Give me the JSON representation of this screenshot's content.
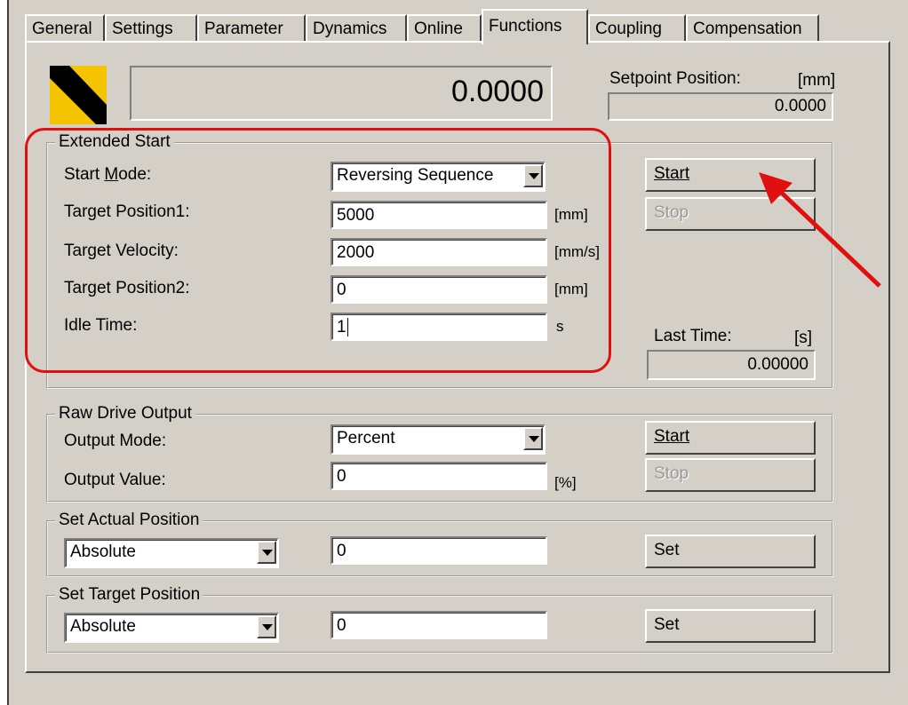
{
  "tabs": [
    {
      "label": "General",
      "active": false
    },
    {
      "label": "Settings",
      "active": false
    },
    {
      "label": "Parameter",
      "active": false
    },
    {
      "label": "Dynamics",
      "active": false
    },
    {
      "label": "Online",
      "active": false
    },
    {
      "label": "Functions",
      "active": true
    },
    {
      "label": "Coupling",
      "active": false
    },
    {
      "label": "Compensation",
      "active": false
    }
  ],
  "logo": {
    "colors": [
      "#f5c400",
      "#000000"
    ],
    "icon": "warning-stripes-icon"
  },
  "actual_value": "0.0000",
  "setpoint": {
    "label": "Setpoint Position:",
    "unit": "[mm]",
    "value": "0.0000"
  },
  "extended_start": {
    "title": "Extended Start",
    "start_mode": {
      "label": "Start Mode:",
      "value": "Reversing Sequence"
    },
    "target_position1": {
      "label": "Target Position1:",
      "value": "5000",
      "unit": "[mm]"
    },
    "target_velocity": {
      "label": "Target Velocity:",
      "value": "2000",
      "unit": "[mm/s]"
    },
    "target_position2": {
      "label": "Target Position2:",
      "value": "0",
      "unit": "[mm]"
    },
    "idle_time": {
      "label": "Idle Time:",
      "value": "1",
      "unit": "s"
    },
    "start_label": "Start",
    "stop_label": "Stop",
    "last_time": {
      "label": "Last Time:",
      "unit": "[s]",
      "value": "0.00000"
    }
  },
  "raw_drive_output": {
    "title": "Raw Drive Output",
    "output_mode": {
      "label": "Output Mode:",
      "value": "Percent"
    },
    "output_value": {
      "label": "Output Value:",
      "value": "0",
      "unit": "[%]"
    },
    "start_label": "Start",
    "stop_label": "Stop"
  },
  "set_actual_position": {
    "title": "Set Actual Position",
    "mode": "Absolute",
    "value": "0",
    "button": "Set"
  },
  "set_target_position": {
    "title": "Set Target Position",
    "mode": "Absolute",
    "value": "0",
    "button": "Set"
  },
  "annotation": {
    "highlight_color": "#e01010",
    "arrow_color": "#e01010"
  }
}
